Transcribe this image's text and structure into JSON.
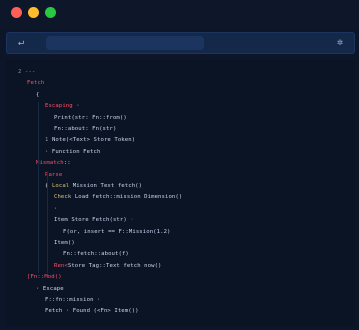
{
  "window": {
    "controls": [
      {
        "name": "close",
        "color": "#ff5f57"
      },
      {
        "name": "minimize",
        "color": "#febc2e"
      },
      {
        "name": "zoom",
        "color": "#28c840"
      }
    ]
  },
  "toolbar": {
    "back_icon": "back-arrow-icon",
    "back_glyph": "↵",
    "address_value": "",
    "settings_icon": "gear-icon",
    "settings_glyph": "✲"
  },
  "code": {
    "colors": {
      "plain": "#c9d6ee",
      "tag": "#ff4d6a",
      "comment": "#7f8fb0",
      "string": "#d9c27a"
    },
    "lines": [
      {
        "indent": 0,
        "tokens": [
          {
            "t": "2 ---",
            "c": "comment"
          }
        ]
      },
      {
        "indent": 1,
        "tokens": [
          {
            "t": "Fetch",
            "c": "tag"
          }
        ]
      },
      {
        "indent": 2,
        "tokens": [
          {
            "t": "{",
            "c": "plain"
          }
        ]
      },
      {
        "indent": 3,
        "tokens": [
          {
            "t": "Escaping",
            "c": "tag"
          },
          {
            "t": " ·",
            "c": "plain"
          }
        ]
      },
      {
        "indent": 4,
        "tokens": [
          {
            "t": "Print(str: Fn::from()",
            "c": "plain"
          }
        ]
      },
      {
        "indent": 4,
        "tokens": [
          {
            "t": "Fn::about: Fn(str)",
            "c": "plain"
          }
        ]
      },
      {
        "indent": 3,
        "tokens": [
          {
            "t": "1   ",
            "c": "comment"
          },
          {
            "t": "Note(<Text> Store  Token)",
            "c": "plain"
          }
        ]
      },
      {
        "indent": 3,
        "tokens": [
          {
            "t": "·     Function  Fetch",
            "c": "plain"
          }
        ]
      },
      {
        "indent": 2,
        "tokens": [
          {
            "t": "Mismatch",
            "c": "tag"
          },
          {
            "t": "::",
            "c": "plain"
          }
        ]
      },
      {
        "indent": 3,
        "tokens": [
          {
            "t": "Parse",
            "c": "tag"
          }
        ]
      },
      {
        "indent": 3,
        "tokens": [
          {
            "t": "{  ",
            "c": "plain"
          },
          {
            "t": "Local",
            "c": "string"
          },
          {
            "t": " Mission  Text  fetch()",
            "c": "plain"
          }
        ]
      },
      {
        "indent": 4,
        "tokens": [
          {
            "t": "Check  ",
            "c": "string"
          },
          {
            "t": "Load  fetch::mission  Dimension()",
            "c": "plain"
          }
        ]
      },
      {
        "indent": 4,
        "tokens": [
          {
            "t": "·",
            "c": "plain"
          }
        ]
      },
      {
        "indent": 4,
        "tokens": [
          {
            "t": "Item Store  Fetch(str)",
            "c": "plain"
          },
          {
            "t": " ·",
            "c": "tag"
          }
        ]
      },
      {
        "indent": 5,
        "tokens": [
          {
            "t": "F(or, insert  ==  F::Mission(1.2)",
            "c": "plain"
          }
        ]
      },
      {
        "indent": 4,
        "tokens": [
          {
            "t": "Item()",
            "c": "plain"
          }
        ]
      },
      {
        "indent": 5,
        "tokens": [
          {
            "t": "Fn::fetch::about(f)",
            "c": "plain"
          }
        ]
      },
      {
        "indent": 4,
        "tokens": [
          {
            "t": "Ren<",
            "c": "tag"
          },
          {
            "t": "Store  Tag::Text  fetch  now()",
            "c": "plain"
          }
        ]
      },
      {
        "indent": 1,
        "tokens": [
          {
            "t": "[Fn::Mod()",
            "c": "tag"
          }
        ]
      },
      {
        "indent": 2,
        "tokens": [
          {
            "t": "·  Escape",
            "c": "plain"
          }
        ]
      },
      {
        "indent": 3,
        "tokens": [
          {
            "t": "F::fn::mission  ·",
            "c": "plain"
          }
        ]
      },
      {
        "indent": 3,
        "tokens": [
          {
            "t": "Fetch  ·  Found (<Fn>  Item())",
            "c": "plain"
          }
        ]
      }
    ]
  }
}
